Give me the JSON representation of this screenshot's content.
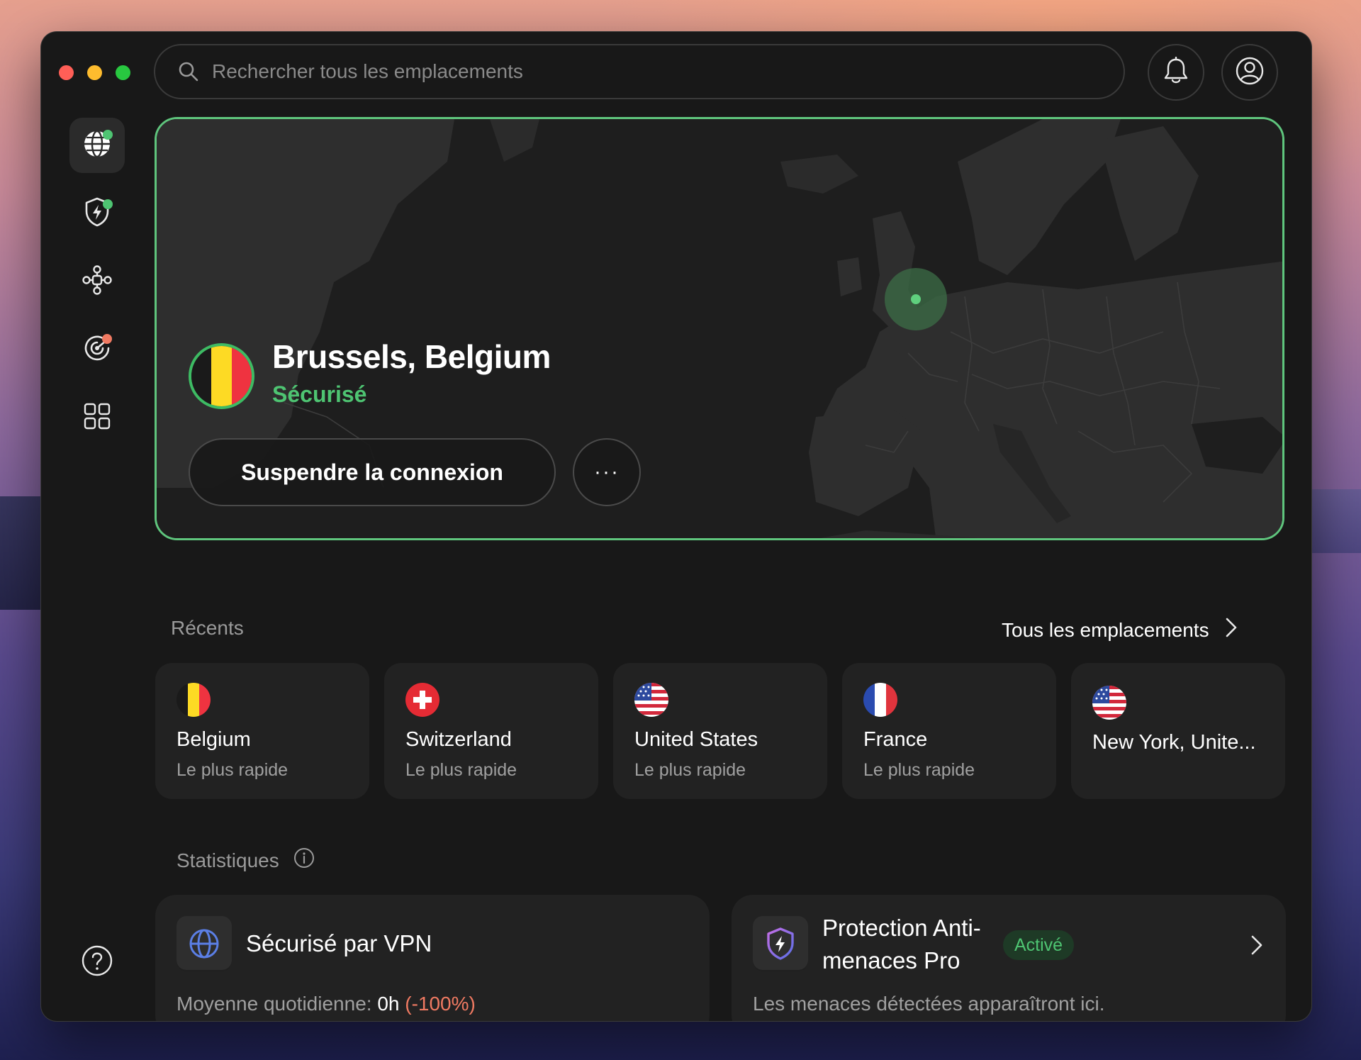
{
  "window": {
    "controls": [
      "close",
      "minimize",
      "maximize"
    ]
  },
  "search": {
    "placeholder": "Rechercher tous les emplacements",
    "value": ""
  },
  "header_icons": [
    "bell-icon",
    "account-icon"
  ],
  "sidebar": {
    "items": [
      {
        "id": "locations",
        "icon": "globe-icon",
        "active": true,
        "indicator": "#4ec472"
      },
      {
        "id": "threat-protection",
        "icon": "shield-bolt-icon",
        "active": false,
        "indicator": "#4ec472"
      },
      {
        "id": "meshnet",
        "icon": "mesh-network-icon",
        "active": false
      },
      {
        "id": "dark-web-monitor",
        "icon": "radar-icon",
        "active": false,
        "indicator": "#f07a62"
      },
      {
        "id": "apps",
        "icon": "grid-icon",
        "active": false
      }
    ],
    "help_icon": "help-icon"
  },
  "hero": {
    "location": "Brussels, Belgium",
    "status": "Sécurisé",
    "flag": [
      "#1a1a1a",
      "#fdda24",
      "#ef3340"
    ],
    "pause_label": "Suspendre la connexion",
    "more_label": "···",
    "accent": "#5fc57d"
  },
  "recents": {
    "label": "Récents",
    "all_link": "Tous les emplacements",
    "items": [
      {
        "name": "Belgium",
        "sub": "Le plus rapide",
        "flag": "belgium"
      },
      {
        "name": "Switzerland",
        "sub": "Le plus rapide",
        "flag": "switzerland"
      },
      {
        "name": "United States",
        "sub": "Le plus rapide",
        "flag": "united-states"
      },
      {
        "name": "France",
        "sub": "Le plus rapide",
        "flag": "france"
      },
      {
        "name": "New York, Unite...",
        "sub": "",
        "flag": "united-states"
      }
    ]
  },
  "stats": {
    "label": "Statistiques",
    "vpn": {
      "title": "Sécurisé par VPN",
      "avg_label": "Moyenne quotidienne: ",
      "avg_value": "0h",
      "avg_change": "(-100%)",
      "change_color": "#f07a62"
    },
    "threat": {
      "title_line1": "Protection Anti-",
      "title_line2": "menaces Pro",
      "badge": "Activé",
      "sub": "Les menaces détectées apparaîtront ici."
    }
  }
}
